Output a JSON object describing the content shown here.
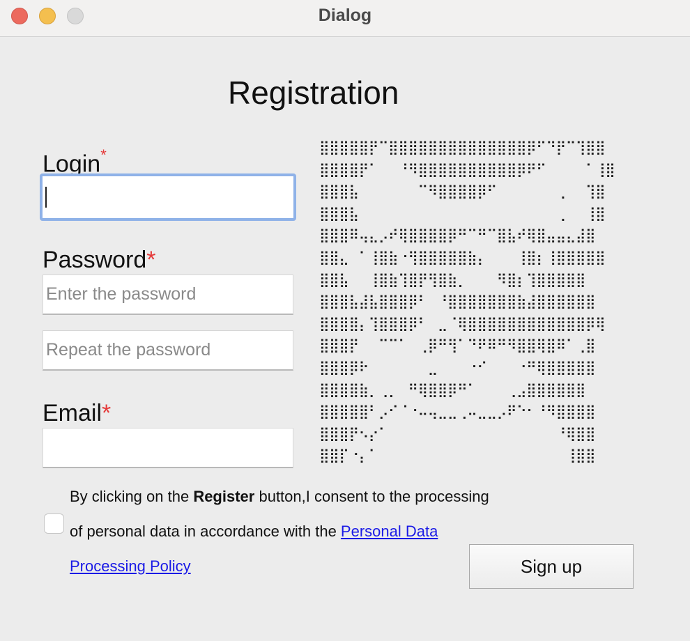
{
  "window": {
    "title": "Dialog"
  },
  "form": {
    "heading": "Registration",
    "login": {
      "label": "Login",
      "required_mark": "*",
      "value": "",
      "placeholder": ""
    },
    "password": {
      "label": "Password",
      "required_mark": "*",
      "placeholder": "Enter the password",
      "repeat_placeholder": "Repeat the password"
    },
    "email": {
      "label": "Email",
      "required_mark": "*",
      "value": "",
      "placeholder": ""
    },
    "consent": {
      "checked": false,
      "line1_before": "By clicking on the ",
      "line1_bold": "Register",
      "line1_after": " button,I consent to the processing",
      "line2_before": "of personal data in accordance with the ",
      "link_part1": "Personal Data",
      "link_part2": "Processing Policy"
    },
    "signup_button": "Sign up"
  },
  "captcha": {
    "rows": [
      "⣿⣿⣿⣿⣿⡟⠉⣿⣿⣿⣿⣿⣿⣿⣿⣿⣿⣿⣿⣿⣿⡿⠋⠙⡟⠉⢹⣿⣿",
      "⣿⣿⣿⣿⡟⠁⠀⠀⠘⠻⣿⣿⣿⣿⣿⣿⣿⣿⣿⣿⡿⠟⠋⠀⠀⠀⠀⠁⢸⣿",
      "⣿⣿⣿⣧⠀⠀⠀⠀⠀⠀⠉⠻⣿⣿⣿⣿⡿⠋⠀⠀⠀⠀⠀⠀⢀⠀⠀⢹⣿",
      "⣿⣿⣿⣧⠀⠀⠀⠀⠀⠀⠀⠀⠀⠀⠀⠀⠀⠀⠀⠀⠀⠀⠀⠀⢀⠀⠀⢸⣿",
      "⣿⣿⣿⠿⢤⣄⡠⠞⢿⣿⣿⣿⣿⡿⠛⠉⠛⠉⣿⣧⠞⢿⣿⣤⣤⣄⣼⣿",
      "⣿⣿⣄⠀⠁⢸⣿⣷⠐⢻⣿⣿⣿⣿⣿⣷⡄⠀⠀⠀⢸⣿⡆⢸⣿⣿⣿⣿⣿",
      "⣿⣿⣧⠀⠀⢸⣿⣷⢹⣿⡟⢻⣿⣷⡀⠀⠀⠀⠻⣿⡆⢹⣿⣿⣿⣿⣿",
      "⣿⣿⣿⣧⣼⣧⣿⣿⣿⡿⠃⠀⠘⣿⣿⣿⣿⣿⣿⣿⣷⣼⣿⣿⣿⣿⣿⣿",
      "⣿⣿⣿⣿⡄⢹⣿⣿⣿⡿⠃⠀⣀⠈⢿⣿⣿⣿⣿⣿⣿⣿⣿⣿⣿⣿⣿⡿⢿",
      "⣿⣿⣿⡟⠀⠀⠉⠉⠁⠀⢀⡿⠛⢻⠁⠙⠟⠿⠛⠻⣿⣿⢿⣿⠿⠁⢀⣿",
      "⣿⣿⣿⡿⠗⠀⠀⠀⠀⠀⠀⣀⠀⠀⠀⠐⠊⠀⠀⠀⠐⠛⢿⣿⣿⣿⣿⣿",
      "⣿⣿⣿⣿⣷⡀⢀⡀⠀⠛⢿⣿⣿⡿⠛⠁⠀⠀⠀⢀⣠⣿⣿⣿⣿⣿⣿",
      "⣿⣿⣿⣿⣿⠃⡠⠊⠈⠐⠤⢤⣀⣀⢀⠤⣀⣀⡠⠟⠑⠂⠘⠻⣿⣿⣿⣿",
      "⣿⣿⣿⡟⠢⡔⠁⠀⠀⠀⠀⠀⠀⠀⠀⠀⠀⠀⠀⠀⠀⠀⠀⠀⠘⢿⣿⣿",
      "⣿⣿⡏⠐⡄⠁⠀⠀⠀⠀⠀⠀⠀⠀⠀⠀⠀⠀⠀⠀⠀⠀⠀⠀⠀⢸⣿⣿"
    ]
  }
}
